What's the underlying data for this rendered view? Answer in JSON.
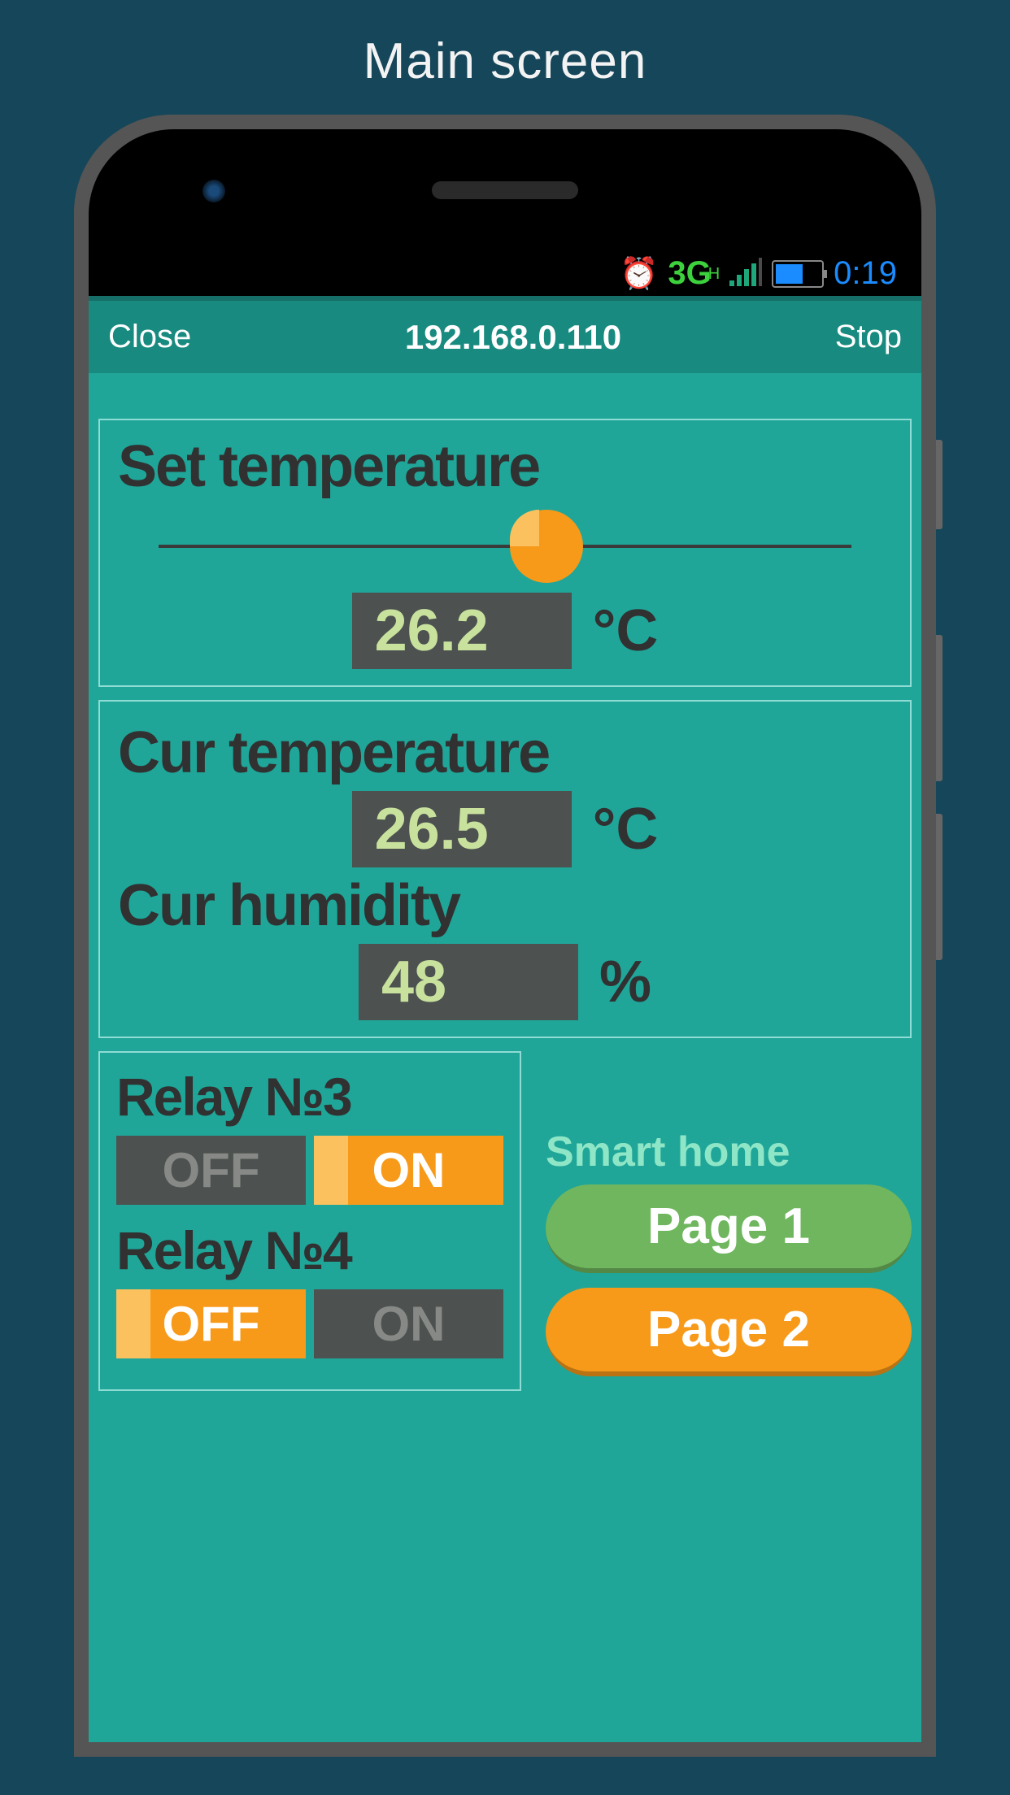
{
  "page_title": "Main screen",
  "status_bar": {
    "network": "3G",
    "time": "0:19"
  },
  "app_bar": {
    "close": "Close",
    "address": "192.168.0.110",
    "stop": "Stop"
  },
  "set_temp": {
    "title": "Set temperature",
    "value": "26.2",
    "unit": "°C",
    "slider_pct": 56
  },
  "readings": {
    "temp_label": "Cur temperature",
    "temp_value": "26.5",
    "temp_unit": "°C",
    "hum_label": "Cur humidity",
    "hum_value": "48",
    "hum_unit": "%"
  },
  "relays": [
    {
      "label": "Relay №3",
      "off": "OFF",
      "on": "ON",
      "state": "ON"
    },
    {
      "label": "Relay №4",
      "off": "OFF",
      "on": "ON",
      "state": "OFF"
    }
  ],
  "nav": {
    "title": "Smart home",
    "page1": "Page 1",
    "page2": "Page 2"
  }
}
